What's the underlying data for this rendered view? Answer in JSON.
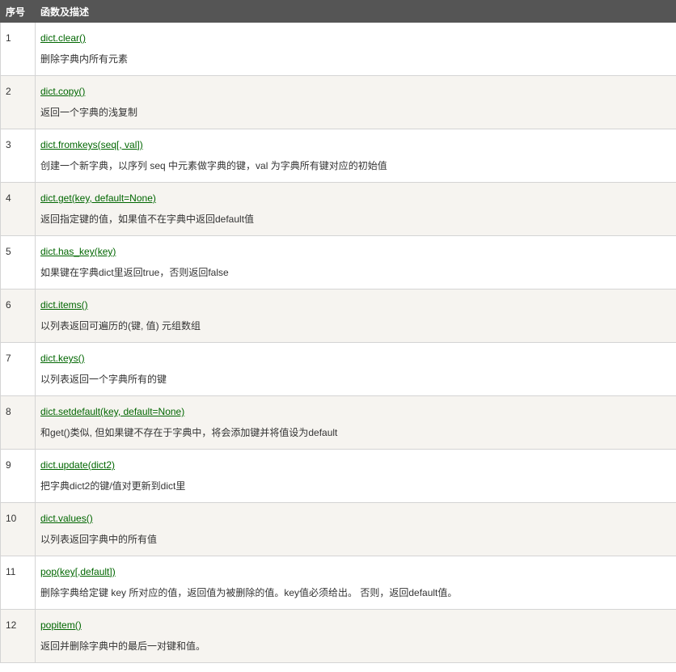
{
  "header": {
    "col_num": "序号",
    "col_desc": "函数及描述"
  },
  "rows": [
    {
      "num": "1",
      "func": "dict.clear()",
      "desc": "删除字典内所有元素"
    },
    {
      "num": "2",
      "func": "dict.copy()",
      "desc": "返回一个字典的浅复制"
    },
    {
      "num": "3",
      "func": "dict.fromkeys(seq[, val])",
      "desc": "创建一个新字典，以序列 seq 中元素做字典的键，val 为字典所有键对应的初始值"
    },
    {
      "num": "4",
      "func": "dict.get(key, default=None)",
      "desc": "返回指定键的值，如果值不在字典中返回default值"
    },
    {
      "num": "5",
      "func": "dict.has_key(key)",
      "desc": "如果键在字典dict里返回true，否则返回false"
    },
    {
      "num": "6",
      "func": "dict.items()",
      "desc": "以列表返回可遍历的(键, 值) 元组数组"
    },
    {
      "num": "7",
      "func": "dict.keys()",
      "desc": "以列表返回一个字典所有的键"
    },
    {
      "num": "8",
      "func": "dict.setdefault(key, default=None)",
      "desc": "和get()类似, 但如果键不存在于字典中，将会添加键并将值设为default"
    },
    {
      "num": "9",
      "func": "dict.update(dict2)",
      "desc": "把字典dict2的键/值对更新到dict里"
    },
    {
      "num": "10",
      "func": "dict.values()",
      "desc": "以列表返回字典中的所有值"
    },
    {
      "num": "11",
      "func": "pop(key[,default])",
      "desc": "删除字典给定键 key 所对应的值，返回值为被删除的值。key值必须给出。 否则，返回default值。"
    },
    {
      "num": "12",
      "func": "popitem()",
      "desc": "返回并删除字典中的最后一对键和值。"
    }
  ],
  "colors": {
    "header_bg": "#555555",
    "link": "#006600",
    "stripe": "#f6f4f0"
  }
}
